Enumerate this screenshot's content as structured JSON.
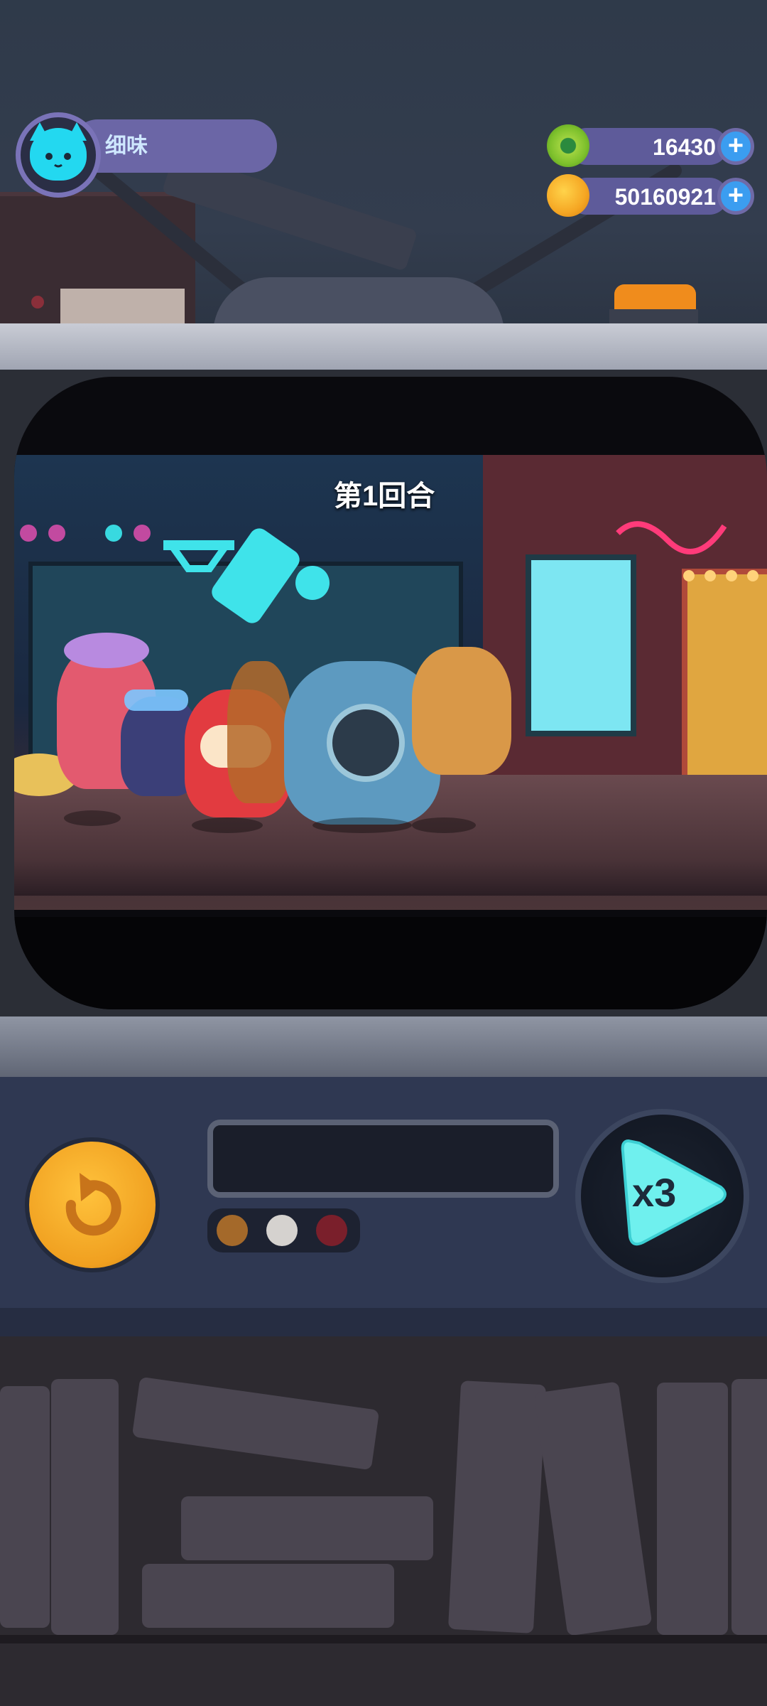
{
  "player": {
    "name": "细味",
    "avatar": "cat-face-avatar"
  },
  "currency": {
    "donuts": "16430",
    "coins": "50160921",
    "add_icon": "+"
  },
  "battle": {
    "round_label": "第1回合"
  },
  "controls": {
    "restart_icon": "restart-arrow-icon",
    "speed_label": "x3",
    "speed_icon": "play-triangle-icon",
    "status_lights": [
      "orange",
      "white",
      "red"
    ]
  },
  "colors": {
    "accent_cyan": "#4fe3e8",
    "profile_purple": "#6b66a6",
    "restart_orange": "#f0a020",
    "plus_blue": "#3b9df0"
  }
}
